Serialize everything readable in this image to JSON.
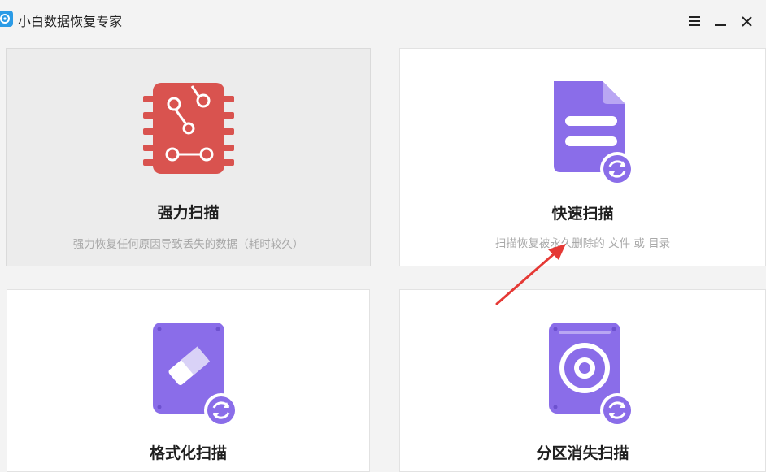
{
  "app": {
    "title": "小白数据恢复专家"
  },
  "window_controls": [
    {
      "icon": "menu-icon"
    },
    {
      "icon": "minimize-icon"
    },
    {
      "icon": "close-icon"
    }
  ],
  "cards": [
    {
      "title": "强力扫描",
      "description": "强力恢复任何原因导致丢失的数据（耗时较久）",
      "icon": "chip-icon",
      "selected": true,
      "icon_color": "#d9534f"
    },
    {
      "title": "快速扫描",
      "description": "扫描恢复被永久删除的 文件 或 目录",
      "icon": "document-icon",
      "selected": false,
      "icon_color": "#8a6de9"
    },
    {
      "title": "格式化扫描",
      "description": "",
      "icon": "eraser-disk-icon",
      "selected": false,
      "icon_color": "#8a6de9"
    },
    {
      "title": "分区消失扫描",
      "description": "",
      "icon": "hard-disk-icon",
      "selected": false,
      "icon_color": "#8a6de9"
    }
  ],
  "annotation": {
    "arrow_color": "#e53935"
  }
}
